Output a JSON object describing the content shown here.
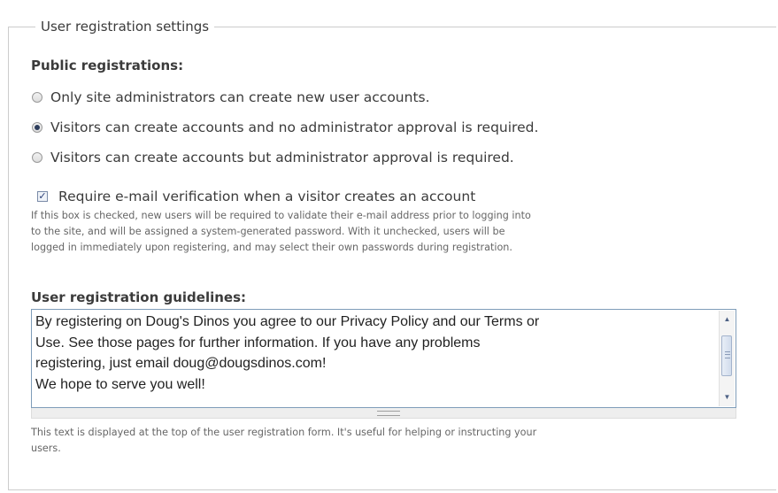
{
  "fieldset": {
    "legend": "User registration settings"
  },
  "public_registrations": {
    "label": "Public registrations:",
    "options": [
      {
        "label": "Only site administrators can create new user accounts.",
        "checked": false
      },
      {
        "label": "Visitors can create accounts and no administrator approval is required.",
        "checked": true
      },
      {
        "label": "Visitors can create accounts but administrator approval is required.",
        "checked": false
      }
    ]
  },
  "email_verification": {
    "label": "Require e-mail verification when a visitor creates an account",
    "checked": true,
    "description_lines": [
      "If this box is checked, new users will be required to validate their e-mail address prior to logging into",
      "to the site, and will be assigned a system-generated password. With it unchecked, users will be",
      "logged in immediately upon registering, and may select their own passwords during registration."
    ]
  },
  "guidelines": {
    "label": "User registration guidelines:",
    "value_lines": [
      "By registering on Doug's Dinos you agree to our Privacy Policy and our Terms or",
      "Use.  See those pages for further information.  If you have any problems",
      "registering, just email doug@dougsdinos.com!",
      "We hope to serve you well!"
    ],
    "description_lines": [
      "This text is displayed at the top of the user registration form. It's useful for helping or instructing your",
      "users."
    ]
  },
  "icons": {
    "scroll_up": "scroll-up-arrow-icon",
    "scroll_down": "scroll-down-arrow-icon",
    "resize": "resize-grippie-icon"
  },
  "colors": {
    "text": "#3b3b3b",
    "description": "#666666",
    "border": "#cccccc",
    "textarea_border": "#7f9db9"
  }
}
